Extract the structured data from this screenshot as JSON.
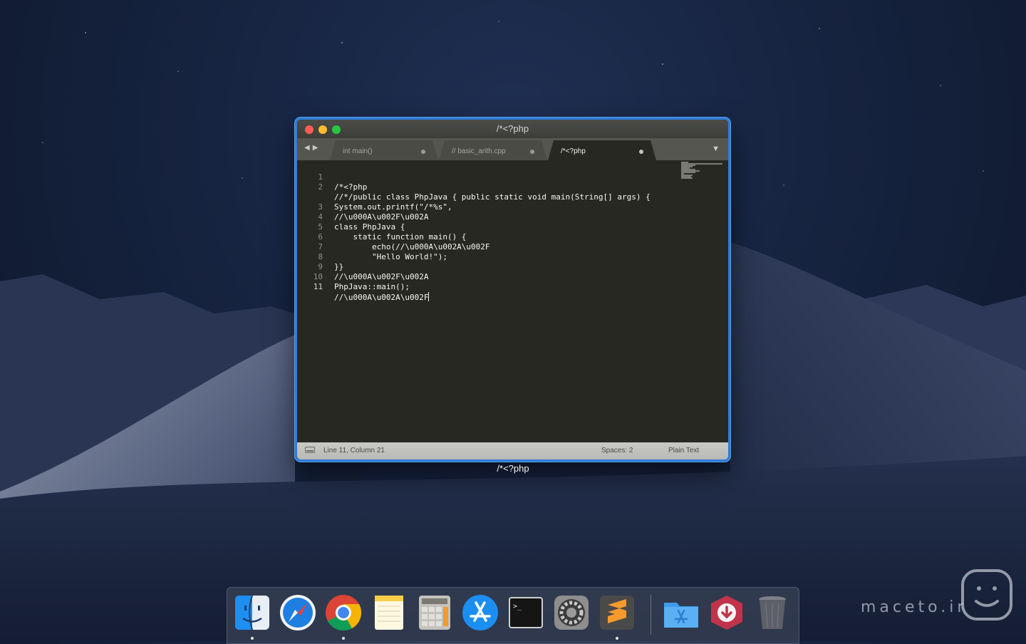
{
  "window": {
    "title": "/*<?php",
    "caption": "/*<?php"
  },
  "tabs": [
    {
      "label": "int main()",
      "active": false
    },
    {
      "label": "// basic_arith.cpp",
      "active": false
    },
    {
      "label": "/*<?php",
      "active": true
    }
  ],
  "code": [
    {
      "no": "1",
      "text": "/*<?php"
    },
    {
      "no": "2",
      "text": "//*/public class PhpJava { public static void main(String[] args) {"
    },
    {
      "no": "",
      "text": "System.out.printf(\"/*%s\","
    },
    {
      "no": "3",
      "text": "//\\u000A\\u002F\\u002A"
    },
    {
      "no": "4",
      "text": "class PhpJava {"
    },
    {
      "no": "5",
      "text": "    static function main() {"
    },
    {
      "no": "6",
      "text": "        echo(//\\u000A\\u002A\\u002F"
    },
    {
      "no": "7",
      "text": "        \"Hello World!\");"
    },
    {
      "no": "8",
      "text": "}}"
    },
    {
      "no": "9",
      "text": "//\\u000A\\u002F\\u002A"
    },
    {
      "no": "10",
      "text": "PhpJava::main();"
    },
    {
      "no": "11",
      "text": "//\\u000A\\u002A\\u002F"
    }
  ],
  "status": {
    "position": "Line 11, Column 21",
    "spaces": "Spaces: 2",
    "syntax": "Plain Text"
  },
  "dock": {
    "apps": [
      "finder-icon",
      "safari-icon",
      "chrome-icon",
      "notes-icon",
      "calculator-icon",
      "app-store-icon",
      "terminal-icon",
      "system-preferences-icon",
      "sublime-text-icon",
      "applications-folder-icon",
      "downloader-icon",
      "trash-icon"
    ]
  },
  "watermark": {
    "latin": "maceto.ir"
  },
  "colors": {
    "editor_bg": "#272822",
    "window_border": "#2f7bd9"
  }
}
